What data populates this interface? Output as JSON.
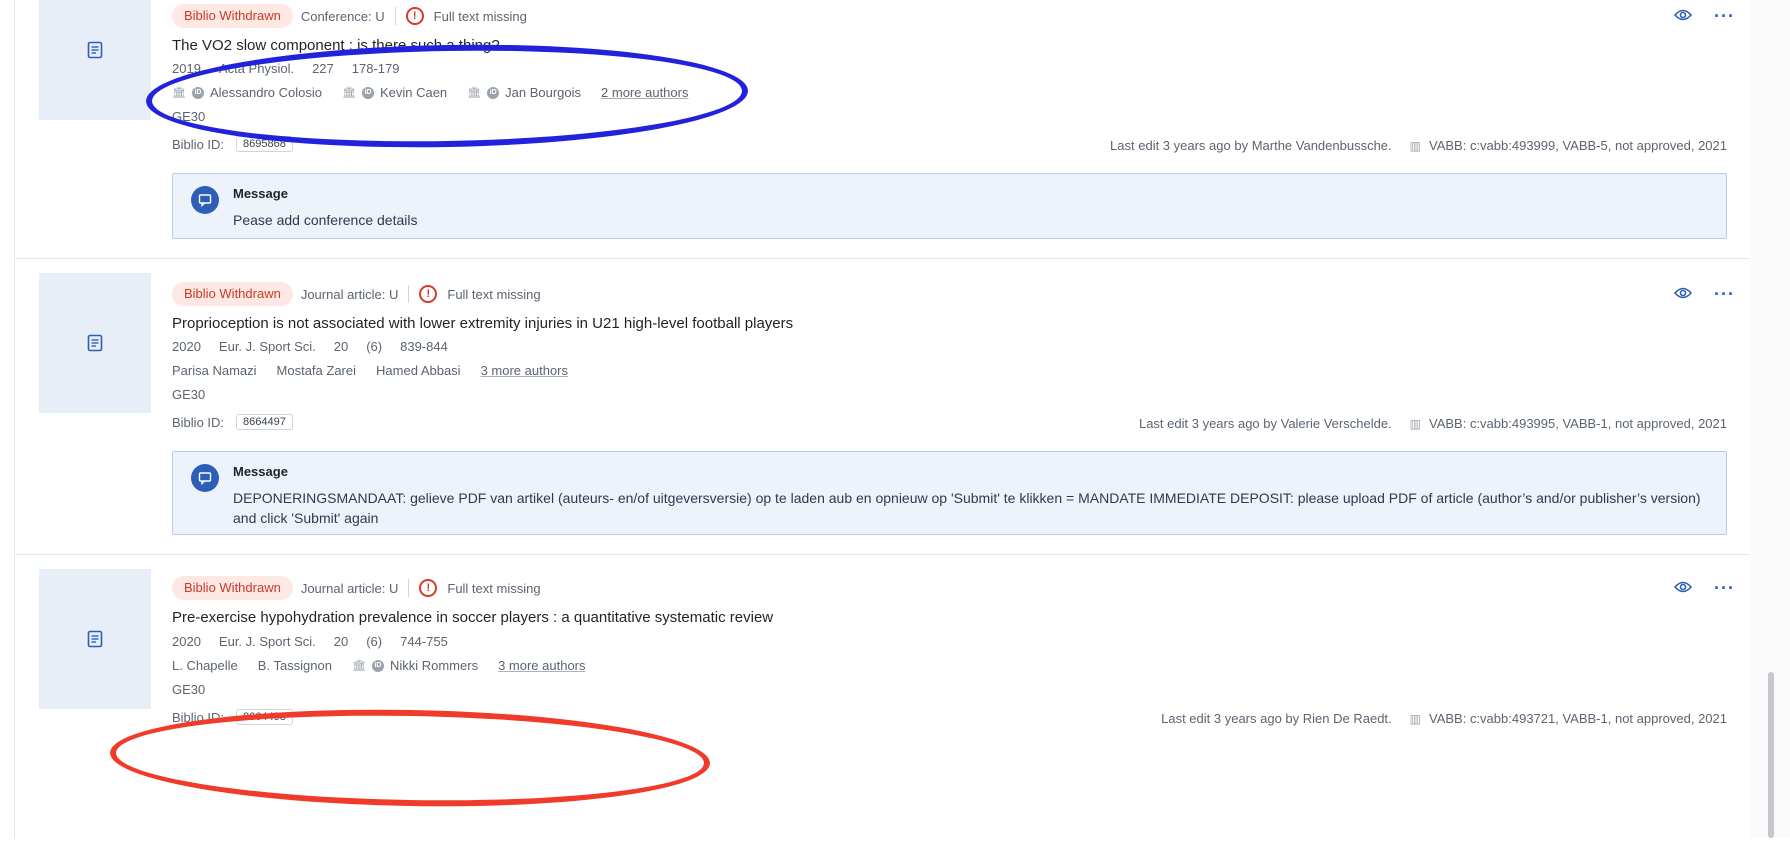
{
  "cards": [
    {
      "status": "Biblio Withdrawn",
      "type": "Conference: U",
      "fulltext": "Full text missing",
      "title": "The VO2 slow component : is there such a thing?",
      "year": "2019",
      "journal": "Acta Physiol.",
      "volume": "227",
      "issue": "",
      "pages": "178-179",
      "authors": [
        "Alessandro Colosio",
        "Kevin Caen",
        "Jan Bourgois"
      ],
      "more_authors": "2 more authors",
      "department": "GE30",
      "biblio_id_label": "Biblio ID:",
      "biblio_id": "8695868",
      "last_edit": "Last edit 3 years ago by Marthe Vandenbussche.",
      "vabb": "VABB: c:vabb:493999, VABB-5, not approved, 2021",
      "message_label": "Message",
      "message": "Pease add conference details"
    },
    {
      "status": "Biblio Withdrawn",
      "type": "Journal article: U",
      "fulltext": "Full text missing",
      "title": "Proprioception is not associated with lower extremity injuries in U21 high-level football players",
      "year": "2020",
      "journal": "Eur. J. Sport Sci.",
      "volume": "20",
      "issue": "(6)",
      "pages": "839-844",
      "authors": [
        "Parisa Namazi",
        "Mostafa Zarei",
        "Hamed Abbasi"
      ],
      "more_authors": "3 more authors",
      "department": "GE30",
      "biblio_id_label": "Biblio ID:",
      "biblio_id": "8664497",
      "last_edit": "Last edit 3 years ago by Valerie Verschelde.",
      "vabb": "VABB: c:vabb:493995, VABB-1, not approved, 2021",
      "message_label": "Message",
      "message": "DEPONERINGSMANDAAT: gelieve PDF van artikel (auteurs- en/of uitgeversversie) op te laden aub en opnieuw op 'Submit' te klikken = MANDATE IMMEDIATE DEPOSIT: please upload PDF of article (author’s and/or publisher’s version) and click 'Submit' again"
    },
    {
      "status": "Biblio Withdrawn",
      "type": "Journal article: U",
      "fulltext": "Full text missing",
      "title": "Pre-exercise hypohydration prevalence in soccer players : a quantitative systematic review",
      "year": "2020",
      "journal": "Eur. J. Sport Sci.",
      "volume": "20",
      "issue": "(6)",
      "pages": "744-755",
      "authors": [
        "L. Chapelle",
        "B. Tassignon",
        "Nikki Rommers"
      ],
      "more_authors": "3 more authors",
      "department": "GE30",
      "biblio_id_label": "Biblio ID:",
      "biblio_id": "8664498",
      "last_edit": "Last edit 3 years ago by Rien De Raedt.",
      "vabb": "VABB: c:vabb:493721, VABB-1, not approved, 2021"
    }
  ],
  "colors": {
    "accent": "#2d5fb8",
    "badge_bg": "#fde8e4",
    "badge_text": "#c93b28",
    "annotation_blue": "#2222dd",
    "annotation_red": "#f03a2a"
  },
  "icons": {
    "thumb": "document-icon",
    "view": "eye-icon",
    "menu": "ellipsis-icon",
    "alert": "exclamation-circle-icon",
    "institution": "institution-icon",
    "orcid": "orcid-icon",
    "stats": "bar-chart-icon",
    "message": "chat-icon"
  }
}
